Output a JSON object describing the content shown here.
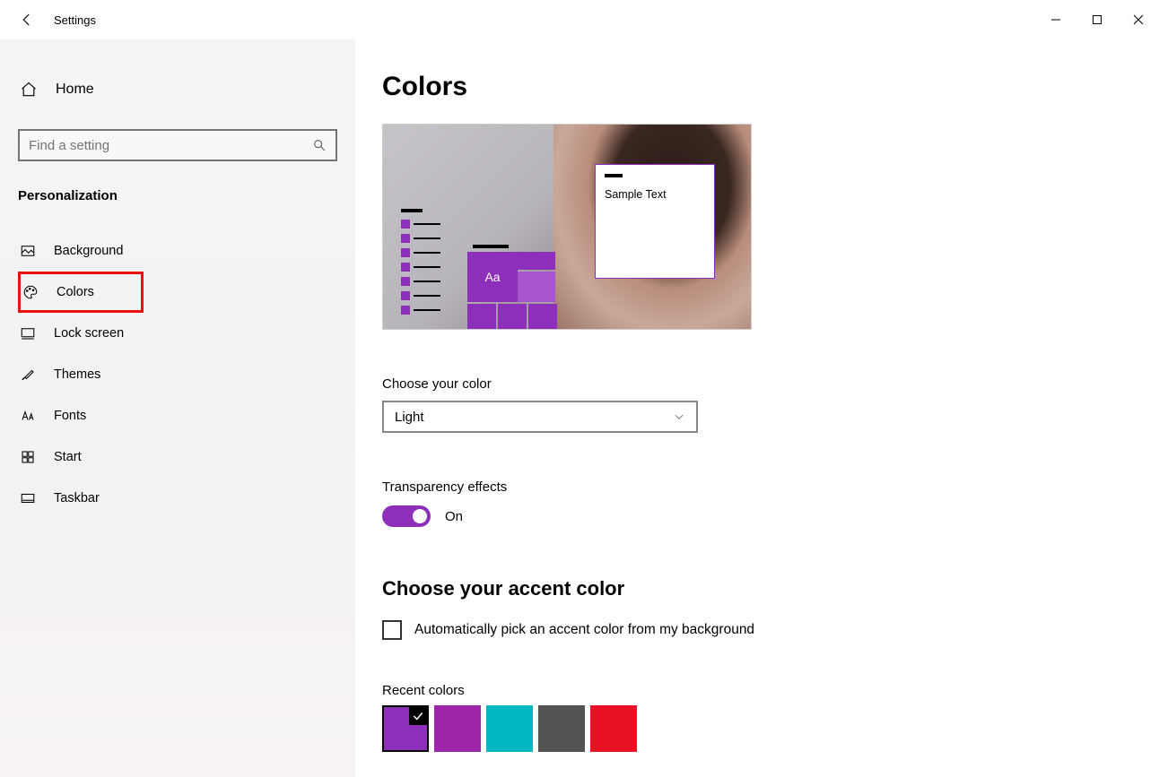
{
  "window": {
    "title": "Settings"
  },
  "sidebar": {
    "home_label": "Home",
    "search_placeholder": "Find a setting",
    "section_label": "Personalization",
    "items": [
      {
        "label": "Background"
      },
      {
        "label": "Colors"
      },
      {
        "label": "Lock screen"
      },
      {
        "label": "Themes"
      },
      {
        "label": "Fonts"
      },
      {
        "label": "Start"
      },
      {
        "label": "Taskbar"
      }
    ]
  },
  "content": {
    "page_title": "Colors",
    "preview": {
      "sample_text": "Sample Text",
      "tile_letter": "Aa",
      "accent_color": "#8e2fbb"
    },
    "choose_color": {
      "label": "Choose your color",
      "selected": "Light"
    },
    "transparency": {
      "label": "Transparency effects",
      "state": "On"
    },
    "accent": {
      "title": "Choose your accent color",
      "auto_label": "Automatically pick an accent color from my background",
      "auto_checked": false
    },
    "recent": {
      "label": "Recent colors",
      "colors": [
        "#8e2fbb",
        "#9d25aa",
        "#00b7c3",
        "#545454",
        "#e81123"
      ],
      "selected_index": 0
    }
  }
}
